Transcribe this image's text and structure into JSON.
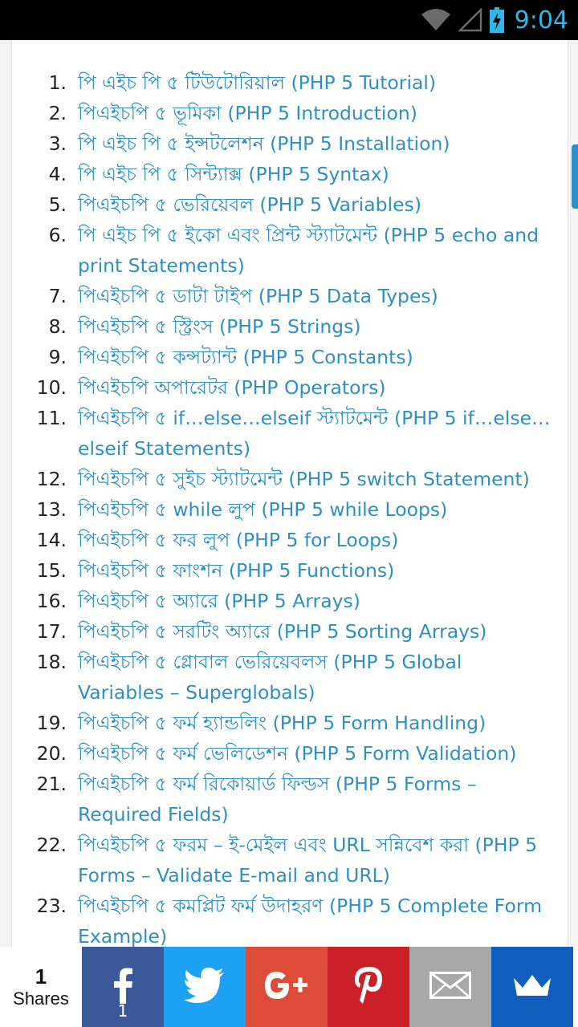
{
  "status_bar": {
    "time": "9:04",
    "icons": [
      "wifi-icon",
      "signal-icon",
      "battery-charging-icon"
    ]
  },
  "toc": [
    {
      "num": "1.",
      "text": "পি এইচ পি ৫ টিউটোরিয়াল (PHP 5 Tutorial)"
    },
    {
      "num": "2.",
      "text": "পিএইচপি ৫ ভূমিকা (PHP 5 Introduction)"
    },
    {
      "num": "3.",
      "text": "পি এইচ পি ৫ ইন্সটলেশন (PHP 5 Installation)"
    },
    {
      "num": "4.",
      "text": "পি এইচ পি ৫ সিন্ট্যাক্স (PHP 5 Syntax)"
    },
    {
      "num": "5.",
      "text": "পিএইচপি ৫ ভেরিয়েবল (PHP 5 Variables)"
    },
    {
      "num": "6.",
      "text": "পি এইচ পি ৫ ইকো এবং প্রিন্ট স্ট্যাটমেন্ট (PHP 5 echo and print Statements)"
    },
    {
      "num": "7.",
      "text": "পিএইচপি ৫ ডাটা টাইপ (PHP 5 Data Types)"
    },
    {
      "num": "8.",
      "text": "পিএইচপি ৫ স্ট্রিংস (PHP 5 Strings)"
    },
    {
      "num": "9.",
      "text": "পিএইচপি ৫ কন্সট্যান্ট (PHP 5 Constants)"
    },
    {
      "num": "10.",
      "text": "পিএইচপি অপারেটর (PHP Operators)"
    },
    {
      "num": "11.",
      "text": "পিএইচপি ৫ if…else…elseif স্ট্যাটমেন্ট (PHP 5 if…else…elseif Statements)"
    },
    {
      "num": "12.",
      "text": "পিএইচপি ৫ সুইচ স্ট্যাটমেন্ট (PHP 5 switch Statement)"
    },
    {
      "num": "13.",
      "text": "পিএইচপি ৫ while লুপ (PHP 5 while Loops)"
    },
    {
      "num": "14.",
      "text": "পিএইচপি ৫ ফর লুপ (PHP 5 for Loops)"
    },
    {
      "num": "15.",
      "text": "পিএইচপি ৫ ফাংশন (PHP 5 Functions)"
    },
    {
      "num": "16.",
      "text": "পিএইচপি ৫ অ্যারে (PHP 5 Arrays)"
    },
    {
      "num": "17.",
      "text": "পিএইচপি ৫ সরটিং অ্যারে (PHP 5 Sorting Arrays)"
    },
    {
      "num": "18.",
      "text": "পিএইচপি ৫ গ্লোবাল ভেরিয়েবলস (PHP 5 Global Variables – Superglobals)"
    },
    {
      "num": "19.",
      "text": "পিএইচপি ৫ ফর্ম হ্যান্ডলিং (PHP 5 Form Handling)"
    },
    {
      "num": "20.",
      "text": "পিএইচপি ৫ ফর্ম ভেলিডেশন (PHP 5 Form Validation)"
    },
    {
      "num": "21.",
      "text": "পিএইচপি ৫ ফর্ম রিকোয়ার্ড ফিল্ডস (PHP 5 Forms – Required Fields)"
    },
    {
      "num": "22.",
      "text": "পিএইচপি ৫ ফরম – ই-মেইল এবং URL সন্নিবেশ করা (PHP 5 Forms – Validate E-mail and URL)"
    },
    {
      "num": "23.",
      "text": "পিএইচপি ৫ কমপ্লিট ফর্ম উদাহরণ (PHP 5 Complete Form Example)"
    }
  ],
  "share_bar": {
    "count": "1",
    "label": "Shares",
    "buttons": [
      {
        "name": "facebook-share-button",
        "icon": "facebook-icon",
        "color": "#3b5998",
        "count": "1"
      },
      {
        "name": "twitter-share-button",
        "icon": "twitter-icon",
        "color": "#1da1f2",
        "count": ""
      },
      {
        "name": "google-plus-share-button",
        "icon": "google-plus-icon",
        "color": "#dd4b39",
        "count": ""
      },
      {
        "name": "pinterest-share-button",
        "icon": "pinterest-icon",
        "color": "#cb2027",
        "count": ""
      },
      {
        "name": "email-share-button",
        "icon": "email-icon",
        "color": "#a8a8a8",
        "count": ""
      },
      {
        "name": "sumo-share-button",
        "icon": "crown-icon",
        "color": "#0f5dbd",
        "count": ""
      }
    ]
  }
}
